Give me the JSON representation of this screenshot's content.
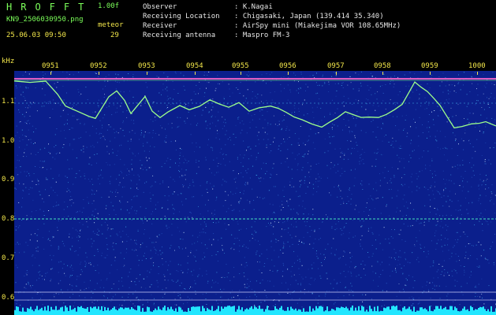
{
  "header": {
    "app_title": "HROFFT",
    "version": "1.00f",
    "filename": "KN9_2506030950.png",
    "meteor_label": "meteor",
    "datetime": "25.06.03 09:50",
    "meteor_count": "29"
  },
  "info": [
    {
      "key": "Observer",
      "value": ": K.Nagai"
    },
    {
      "key": "Receiving Location",
      "value": ": Chigasaki, Japan (139.414 35.340)"
    },
    {
      "key": "Receiver",
      "value": ": AirSpy mini (Miakejima VOR 108.65MHz)"
    },
    {
      "key": "Receiving antenna",
      "value": ": Maspro FM-3"
    }
  ],
  "spectrogram": {
    "unit": "kHz",
    "y_ticks": [
      "1.1",
      "1.0",
      "0.9",
      "0.8",
      "0.7",
      "0.6"
    ],
    "x_ticks": [
      "0951",
      "0952",
      "0953",
      "0954",
      "0955",
      "0956",
      "0957",
      "0958",
      "0959",
      "1000"
    ],
    "colors": {
      "background": "#0b1f8c",
      "noise": "#3a9be0",
      "trace": "#9dff8a",
      "carrier": "#ff66cc",
      "baseline": "#22e6ff"
    }
  }
}
